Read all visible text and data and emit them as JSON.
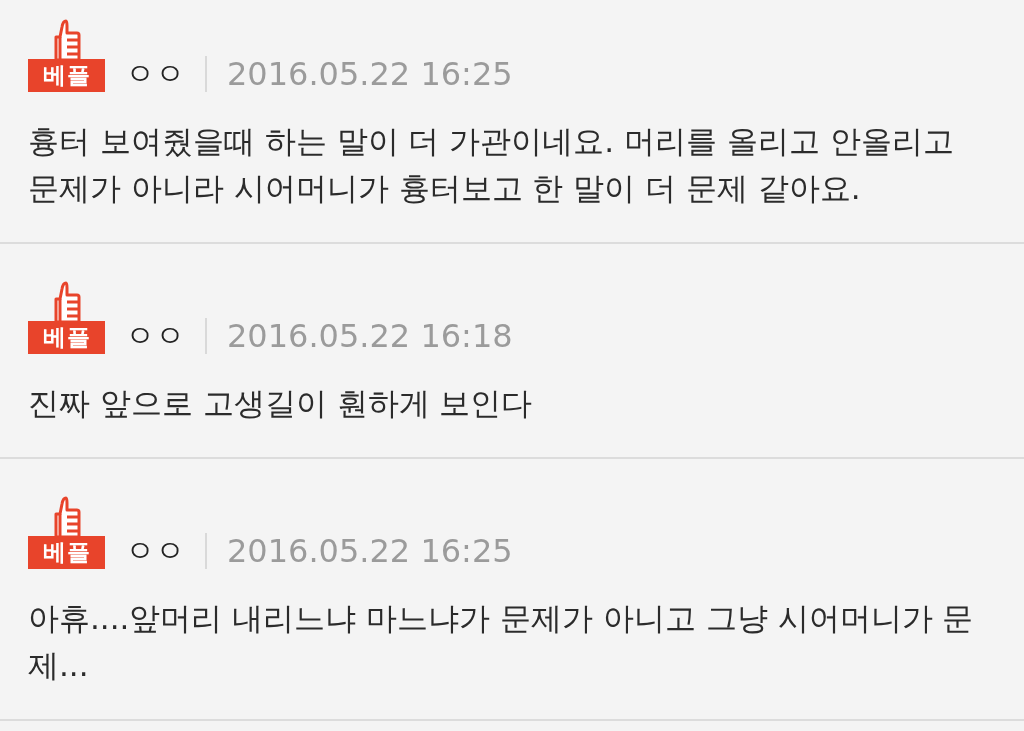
{
  "comments": [
    {
      "badge": "베플",
      "author": "ㅇㅇ",
      "timestamp": "2016.05.22 16:25",
      "text": "흉터 보여줬을때 하는 말이 더 가관이네요. 머리를 올리고 안올리고 문제가 아니라 시어머니가 흉터보고 한 말이 더 문제 같아요."
    },
    {
      "badge": "베플",
      "author": "ㅇㅇ",
      "timestamp": "2016.05.22 16:18",
      "text": "진짜 앞으로 고생길이 훤하게 보인다"
    },
    {
      "badge": "베플",
      "author": "ㅇㅇ",
      "timestamp": "2016.05.22 16:25",
      "text": "아휴....앞머리 내리느냐 마느냐가 문제가 아니고 그냥 시어머니가 문제..."
    }
  ]
}
